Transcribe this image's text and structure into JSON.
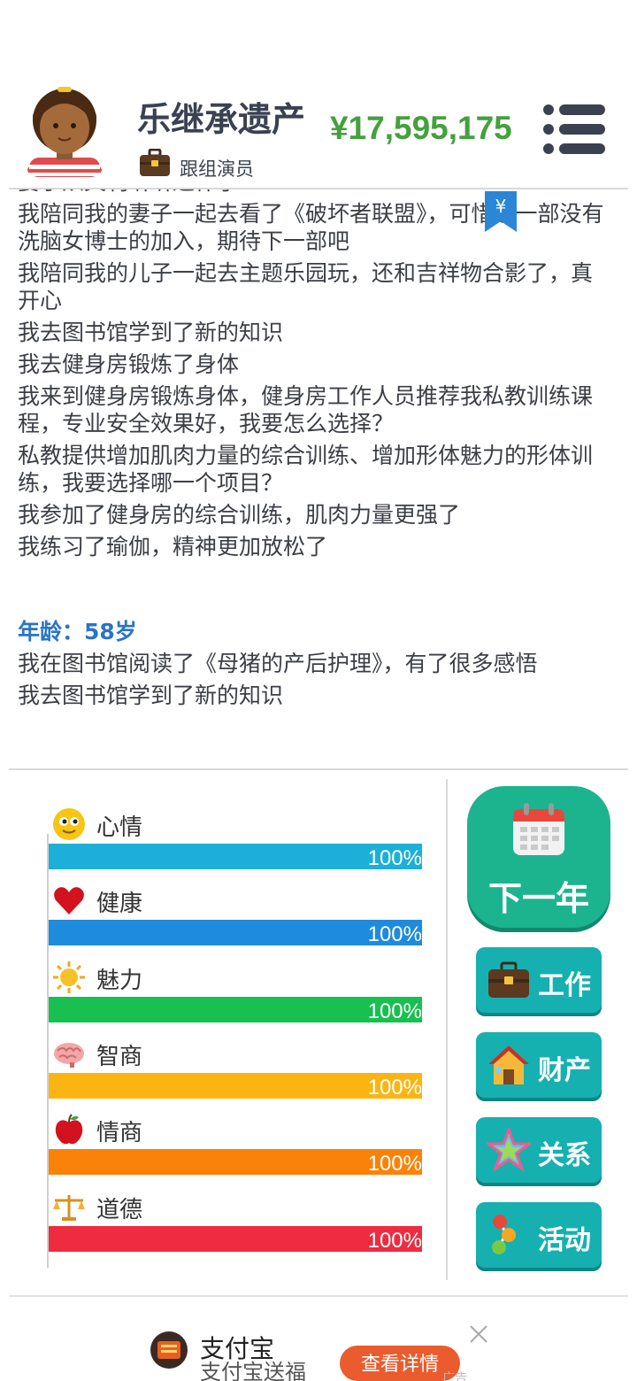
{
  "header": {
    "player_name": "乐继承遗产",
    "job": "跟组演员",
    "money": "¥17,595,175",
    "yen_marker": "¥"
  },
  "log": {
    "lines": [
      "妻子从文利听听退休了",
      "我陪同我的妻子一起去看了《破坏者联盟》，可惜这一部没有洗脑女博士的加入，期待下一部吧",
      "我陪同我的儿子一起去主题乐园玩，还和吉祥物合影了，真开心",
      "我去图书馆学到了新的知识",
      "我去健身房锻炼了身体",
      "我来到健身房锻炼身体，健身房工作人员推荐我私教训练课程，专业安全效果好，我要怎么选择？",
      "私教提供增加肌肉力量的综合训练、增加形体魅力的形体训练，我要选择哪一个项目？",
      "我参加了健身房的综合训练，肌肉力量更强了",
      "我练习了瑜伽，精神更加放松了"
    ],
    "age_label": "年龄：58岁",
    "age_lines": [
      "我在图书馆阅读了《母猪的产后护理》，有了很多感悟",
      "我去图书馆学到了新的知识"
    ]
  },
  "stats": [
    {
      "label": "心情",
      "icon": "smiley-icon",
      "value": 1.0,
      "pct": "100%",
      "color": "#1cb0d8"
    },
    {
      "label": "健康",
      "icon": "heart-icon",
      "value": 1.0,
      "pct": "100%",
      "color": "#1e8bdc"
    },
    {
      "label": "魅力",
      "icon": "sun-icon",
      "value": 1.0,
      "pct": "100%",
      "color": "#17c04f"
    },
    {
      "label": "智商",
      "icon": "brain-icon",
      "value": 1.0,
      "pct": "100%",
      "color": "#fbb512"
    },
    {
      "label": "情商",
      "icon": "apple-icon",
      "value": 1.0,
      "pct": "100%",
      "color": "#fb8208"
    },
    {
      "label": "道德",
      "icon": "scale-icon",
      "value": 1.0,
      "pct": "100%",
      "color": "#ef2b3f"
    }
  ],
  "actions": {
    "next_year": "下一年",
    "work": "工作",
    "property": "财产",
    "relations": "关系",
    "activity": "活动"
  },
  "ad": {
    "title": "支付宝",
    "subtitle": "支付宝送福",
    "button": "查看详情",
    "tag": "广告"
  },
  "colors": {
    "money": "#45a03e",
    "age": "#2a74c8",
    "next_year_bg": "#1cb48f",
    "action_bg": "#16b0b1"
  }
}
